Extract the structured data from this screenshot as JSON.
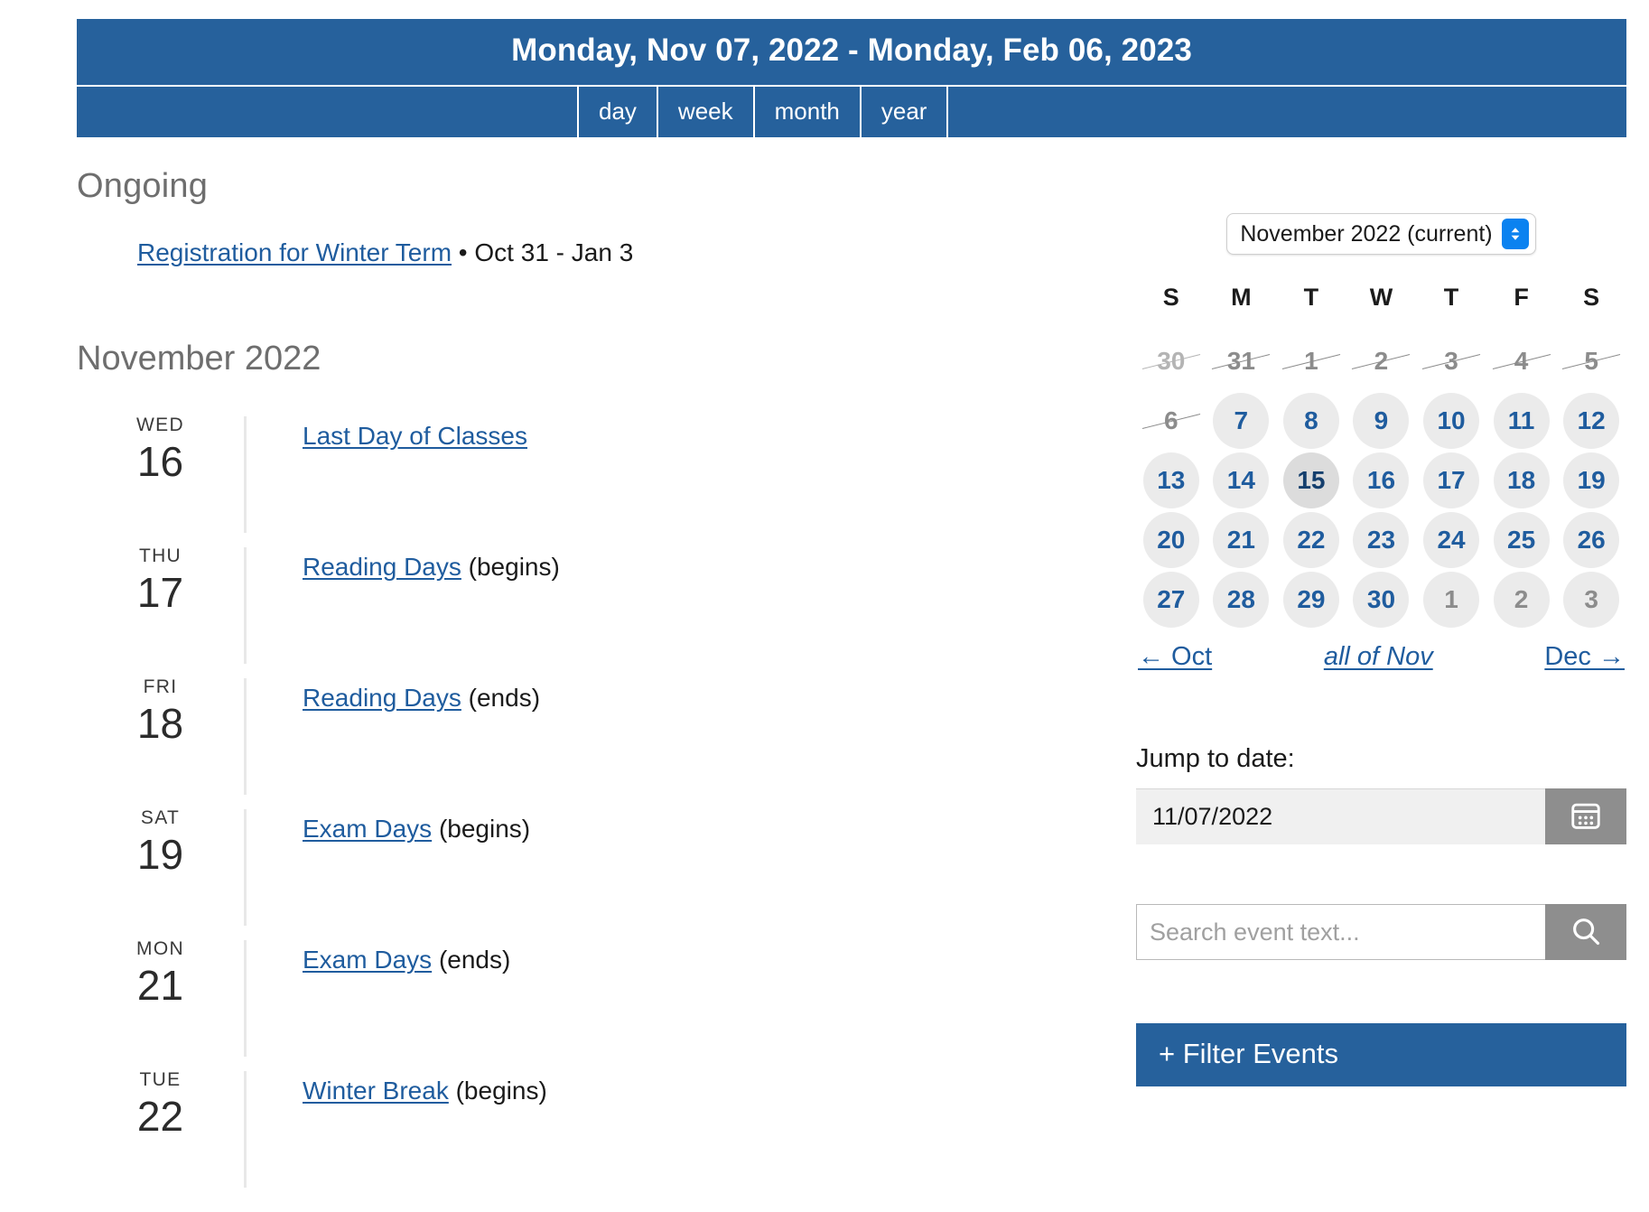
{
  "header": {
    "date_range": "Monday, Nov 07, 2022 - Monday, Feb 06, 2023",
    "tabs": [
      {
        "label": "day"
      },
      {
        "label": "week"
      },
      {
        "label": "month"
      },
      {
        "label": "year"
      }
    ],
    "accent_color": "#26619C"
  },
  "main": {
    "ongoing_title": "Ongoing",
    "ongoing_events": [
      {
        "link": "Registration for Winter Term",
        "separator": "•",
        "range": "Oct 31 - Jan 3"
      }
    ],
    "month_title": "November 2022",
    "events": [
      {
        "dow": "WED",
        "day": "16",
        "link": "Last Day of Classes",
        "suffix": ""
      },
      {
        "dow": "THU",
        "day": "17",
        "link": "Reading Days",
        "suffix": "(begins)"
      },
      {
        "dow": "FRI",
        "day": "18",
        "link": "Reading Days",
        "suffix": "(ends)"
      },
      {
        "dow": "SAT",
        "day": "19",
        "link": "Exam Days",
        "suffix": "(begins)"
      },
      {
        "dow": "MON",
        "day": "21",
        "link": "Exam Days",
        "suffix": "(ends)"
      },
      {
        "dow": "TUE",
        "day": "22",
        "link": "Winter Break",
        "suffix": "(begins)"
      }
    ]
  },
  "sidebar": {
    "month_select": {
      "selected": "November 2022 (current)",
      "options": [
        "November 2022 (current)"
      ]
    },
    "mini_calendar": {
      "weekday_headers": [
        "S",
        "M",
        "T",
        "W",
        "T",
        "F",
        "S"
      ],
      "weeks": [
        [
          {
            "n": "30",
            "state": "struck-faint"
          },
          {
            "n": "31",
            "state": "struck"
          },
          {
            "n": "1",
            "state": "struck"
          },
          {
            "n": "2",
            "state": "struck"
          },
          {
            "n": "3",
            "state": "struck"
          },
          {
            "n": "4",
            "state": "struck"
          },
          {
            "n": "5",
            "state": "struck"
          }
        ],
        [
          {
            "n": "6",
            "state": "struck"
          },
          {
            "n": "7",
            "state": "active"
          },
          {
            "n": "8",
            "state": "active"
          },
          {
            "n": "9",
            "state": "active"
          },
          {
            "n": "10",
            "state": "active"
          },
          {
            "n": "11",
            "state": "active"
          },
          {
            "n": "12",
            "state": "active"
          }
        ],
        [
          {
            "n": "13",
            "state": "active"
          },
          {
            "n": "14",
            "state": "active"
          },
          {
            "n": "15",
            "state": "today"
          },
          {
            "n": "16",
            "state": "active"
          },
          {
            "n": "17",
            "state": "active"
          },
          {
            "n": "18",
            "state": "active"
          },
          {
            "n": "19",
            "state": "active"
          }
        ],
        [
          {
            "n": "20",
            "state": "active"
          },
          {
            "n": "21",
            "state": "active"
          },
          {
            "n": "22",
            "state": "active"
          },
          {
            "n": "23",
            "state": "active"
          },
          {
            "n": "24",
            "state": "active"
          },
          {
            "n": "25",
            "state": "active"
          },
          {
            "n": "26",
            "state": "active"
          }
        ],
        [
          {
            "n": "27",
            "state": "active"
          },
          {
            "n": "28",
            "state": "active"
          },
          {
            "n": "29",
            "state": "active"
          },
          {
            "n": "30",
            "state": "active"
          },
          {
            "n": "1",
            "state": "other"
          },
          {
            "n": "2",
            "state": "other"
          },
          {
            "n": "3",
            "state": "other"
          }
        ]
      ],
      "nav": {
        "prev": "← Oct",
        "all": "all of Nov",
        "next": "Dec →"
      }
    },
    "jump": {
      "label": "Jump to date:",
      "value": "11/07/2022",
      "icon": "calendar-icon"
    },
    "search": {
      "placeholder": "Search event text...",
      "value": "",
      "icon": "search-icon"
    },
    "filter_button": "+ Filter Events"
  }
}
